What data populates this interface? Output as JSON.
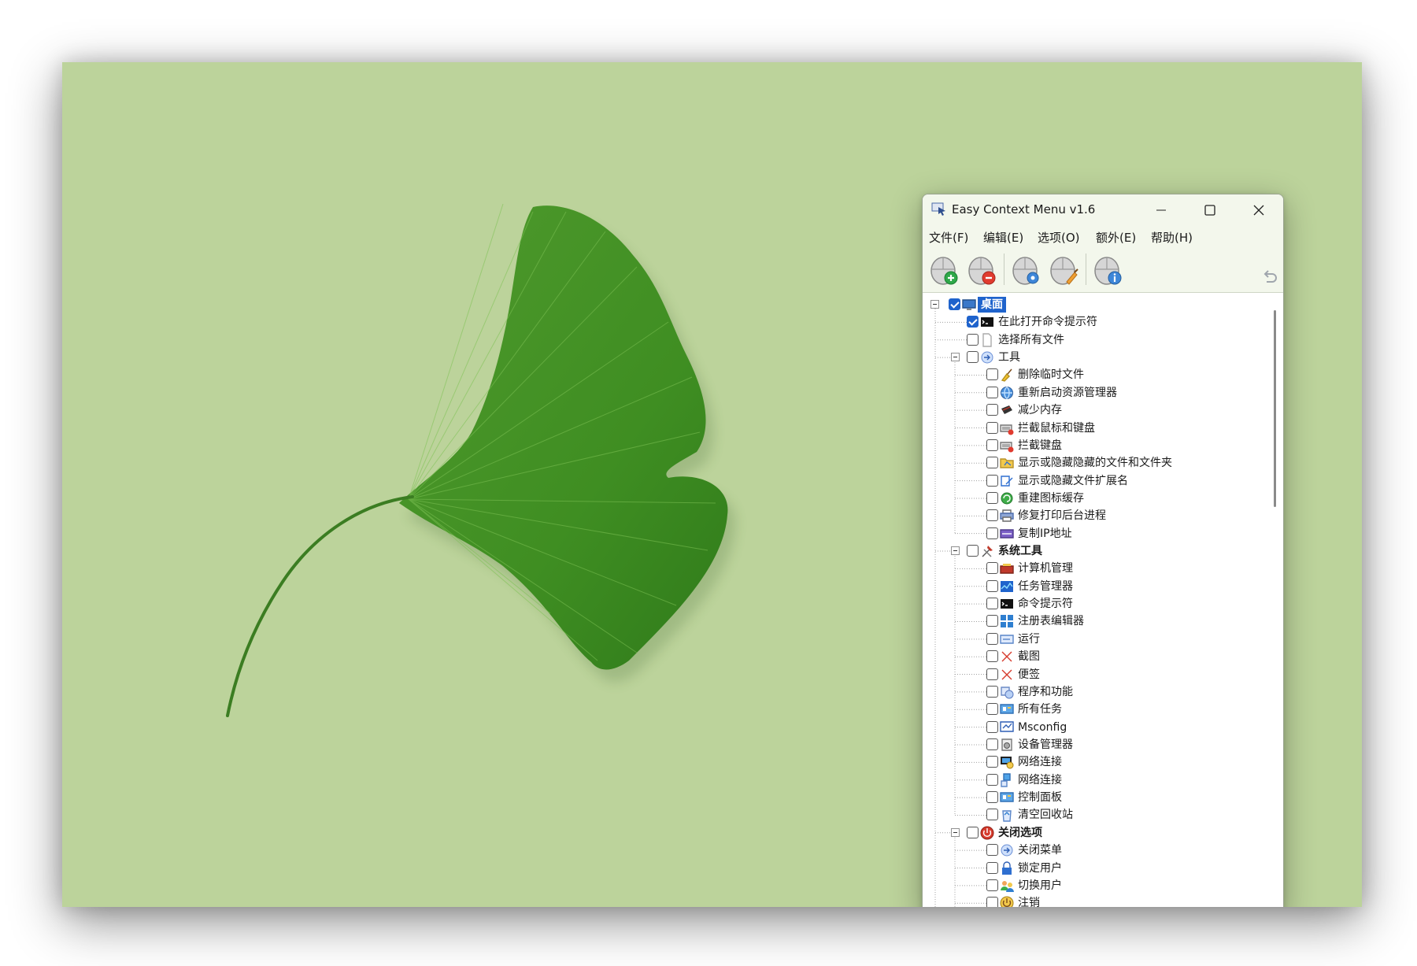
{
  "window": {
    "title": "Easy Context Menu v1.6",
    "menus": [
      "文件(F)",
      "编辑(E)",
      "选项(O)",
      "额外(E)",
      "帮助(H)"
    ]
  },
  "toolbar": {
    "buttons": [
      "add-mouse-icon",
      "remove-mouse-icon",
      "settings-mouse-icon",
      "clean-mouse-icon",
      "info-mouse-icon"
    ],
    "undo": "undo-icon"
  },
  "tree": {
    "root": {
      "label": "桌面",
      "checked": true,
      "icon": "desktop-icon"
    },
    "items": [
      {
        "label": "在此打开命令提示符",
        "level": 1,
        "checked": true,
        "icon": "cmd-icon"
      },
      {
        "label": "选择所有文件",
        "level": 1,
        "checked": false,
        "icon": "blank-file-icon"
      },
      {
        "label": "工具",
        "level": 1,
        "checked": false,
        "icon": "arrow-icon",
        "expandable": true
      },
      {
        "label": "删除临时文件",
        "level": 2,
        "checked": false,
        "icon": "broom-icon"
      },
      {
        "label": "重新启动资源管理器",
        "level": 2,
        "checked": false,
        "icon": "globe-icon"
      },
      {
        "label": "减少内存",
        "level": 2,
        "checked": false,
        "icon": "memory-icon"
      },
      {
        "label": "拦截鼠标和键盘",
        "level": 2,
        "checked": false,
        "icon": "keyboard-block-icon"
      },
      {
        "label": "拦截键盘",
        "level": 2,
        "checked": false,
        "icon": "keyboard-block-icon"
      },
      {
        "label": "显示或隐藏隐藏的文件和文件夹",
        "level": 2,
        "checked": false,
        "icon": "folder-toggle-icon"
      },
      {
        "label": "显示或隐藏文件扩展名",
        "level": 2,
        "checked": false,
        "icon": "extension-icon"
      },
      {
        "label": "重建图标缓存",
        "level": 2,
        "checked": false,
        "icon": "refresh-icon"
      },
      {
        "label": "修复打印后台进程",
        "level": 2,
        "checked": false,
        "icon": "printer-icon"
      },
      {
        "label": "复制IP地址",
        "level": 2,
        "checked": false,
        "icon": "ip-icon"
      },
      {
        "label": "系统工具",
        "level": 1,
        "checked": false,
        "icon": "tools-icon",
        "expandable": true,
        "bold": true
      },
      {
        "label": "计算机管理",
        "level": 2,
        "checked": false,
        "icon": "computer-management-icon"
      },
      {
        "label": "任务管理器",
        "level": 2,
        "checked": false,
        "icon": "task-manager-icon"
      },
      {
        "label": "命令提示符",
        "level": 2,
        "checked": false,
        "icon": "cmd-icon"
      },
      {
        "label": "注册表编辑器",
        "level": 2,
        "checked": false,
        "icon": "registry-icon"
      },
      {
        "label": "运行",
        "level": 2,
        "checked": false,
        "icon": "run-icon"
      },
      {
        "label": "截图",
        "level": 2,
        "checked": false,
        "icon": "red-x-icon"
      },
      {
        "label": "便签",
        "level": 2,
        "checked": false,
        "icon": "red-x-icon"
      },
      {
        "label": "程序和功能",
        "level": 2,
        "checked": false,
        "icon": "programs-icon"
      },
      {
        "label": "所有任务",
        "level": 2,
        "checked": false,
        "icon": "control-panel-icon"
      },
      {
        "label": "Msconfig",
        "level": 2,
        "checked": false,
        "icon": "msconfig-icon"
      },
      {
        "label": "设备管理器",
        "level": 2,
        "checked": false,
        "icon": "device-manager-icon"
      },
      {
        "label": "网络连接",
        "level": 2,
        "checked": false,
        "icon": "network-icon"
      },
      {
        "label": "网络连接",
        "level": 2,
        "checked": false,
        "icon": "network-share-icon"
      },
      {
        "label": "控制面板",
        "level": 2,
        "checked": false,
        "icon": "control-panel-icon"
      },
      {
        "label": "清空回收站",
        "level": 2,
        "checked": false,
        "icon": "recycle-bin-icon"
      },
      {
        "label": "关闭选项",
        "level": 1,
        "checked": false,
        "icon": "power-icon",
        "expandable": true,
        "bold": true
      },
      {
        "label": "关闭菜单",
        "level": 2,
        "checked": false,
        "icon": "arrow-icon"
      },
      {
        "label": "锁定用户",
        "level": 2,
        "checked": false,
        "icon": "lock-icon"
      },
      {
        "label": "切换用户",
        "level": 2,
        "checked": false,
        "icon": "switch-user-icon"
      },
      {
        "label": "注销",
        "level": 2,
        "checked": false,
        "icon": "logoff-icon"
      }
    ]
  },
  "colors": {
    "desktop": "#bcd39b",
    "selection": "#1f63cc",
    "window_chrome": "#f3f7ec"
  }
}
